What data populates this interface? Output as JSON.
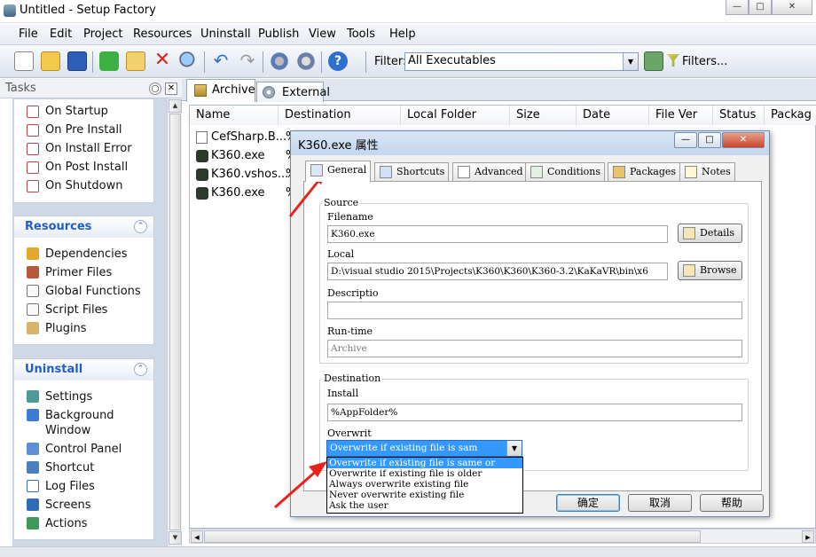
{
  "window": {
    "title": "Untitled - Setup Factory",
    "buttons": [
      "—",
      "□",
      "✕"
    ]
  },
  "menu": [
    "File",
    "Edit",
    "Project",
    "Resources",
    "Uninstall",
    "Publish",
    "View",
    "Tools",
    "Help"
  ],
  "toolbar": {
    "filter_label": "Filter:",
    "filter_value": "All Executables",
    "filters_label": "Filters..."
  },
  "tasks": {
    "title": "Tasks",
    "install_items": [
      "On Startup",
      "On Pre Install",
      "On Install Error",
      "On Post Install",
      "On Shutdown"
    ],
    "resources_title": "Resources",
    "resources_items": [
      "Dependencies",
      "Primer Files",
      "Global Functions",
      "Script Files",
      "Plugins"
    ],
    "uninstall_title": "Uninstall",
    "uninstall_items": [
      "Settings",
      "Background",
      "Window",
      "Control Panel",
      "Shortcut",
      "Log Files",
      "Screens",
      "Actions"
    ]
  },
  "tabs": [
    "Archive",
    "External"
  ],
  "list": {
    "columns": [
      "Name",
      "Destination",
      "Local Folder",
      "Size",
      "Date",
      "File Ver",
      "Status",
      "Packag"
    ],
    "rows": [
      "CefSharp.B...",
      "K360.exe",
      "K360.vshos...",
      "K360.exe"
    ],
    "dest_prefix": "%"
  },
  "dialog": {
    "title": "K360.exe 属性",
    "tabs": [
      "General",
      "Shortcuts",
      "Advanced",
      "Conditions",
      "Packages",
      "Notes"
    ],
    "source_group": "Source",
    "filename_label": "Filename",
    "filename_value": "K360.exe",
    "details_button": "Details",
    "local_label": "Local",
    "local_value": "D:\\visual studio 2015\\Projects\\K360\\K360\\K360-3.2\\KaKaVR\\bin\\x6",
    "browse_button": "Browse",
    "description_label": "Descriptio",
    "runtime_label": "Run-time",
    "runtime_value": "Archive",
    "destination_group": "Destination",
    "install_label": "Install",
    "install_value": "%AppFolder%",
    "overwrite_label": "Overwrit",
    "overwrite_value": "Overwrite if existing file is sam",
    "overwrite_options": [
      "Overwrite if existing file is same or",
      "Overwrite if existing file is older",
      "Always overwrite existing file",
      "Never overwrite existing file",
      "Ask the user"
    ],
    "ok_button": "确定",
    "cancel_button": "取消",
    "help_button": "帮助"
  },
  "colors": {
    "accent": "#215dc6",
    "selection": "#3399ff",
    "annotation_arrow": "#e8231c"
  }
}
